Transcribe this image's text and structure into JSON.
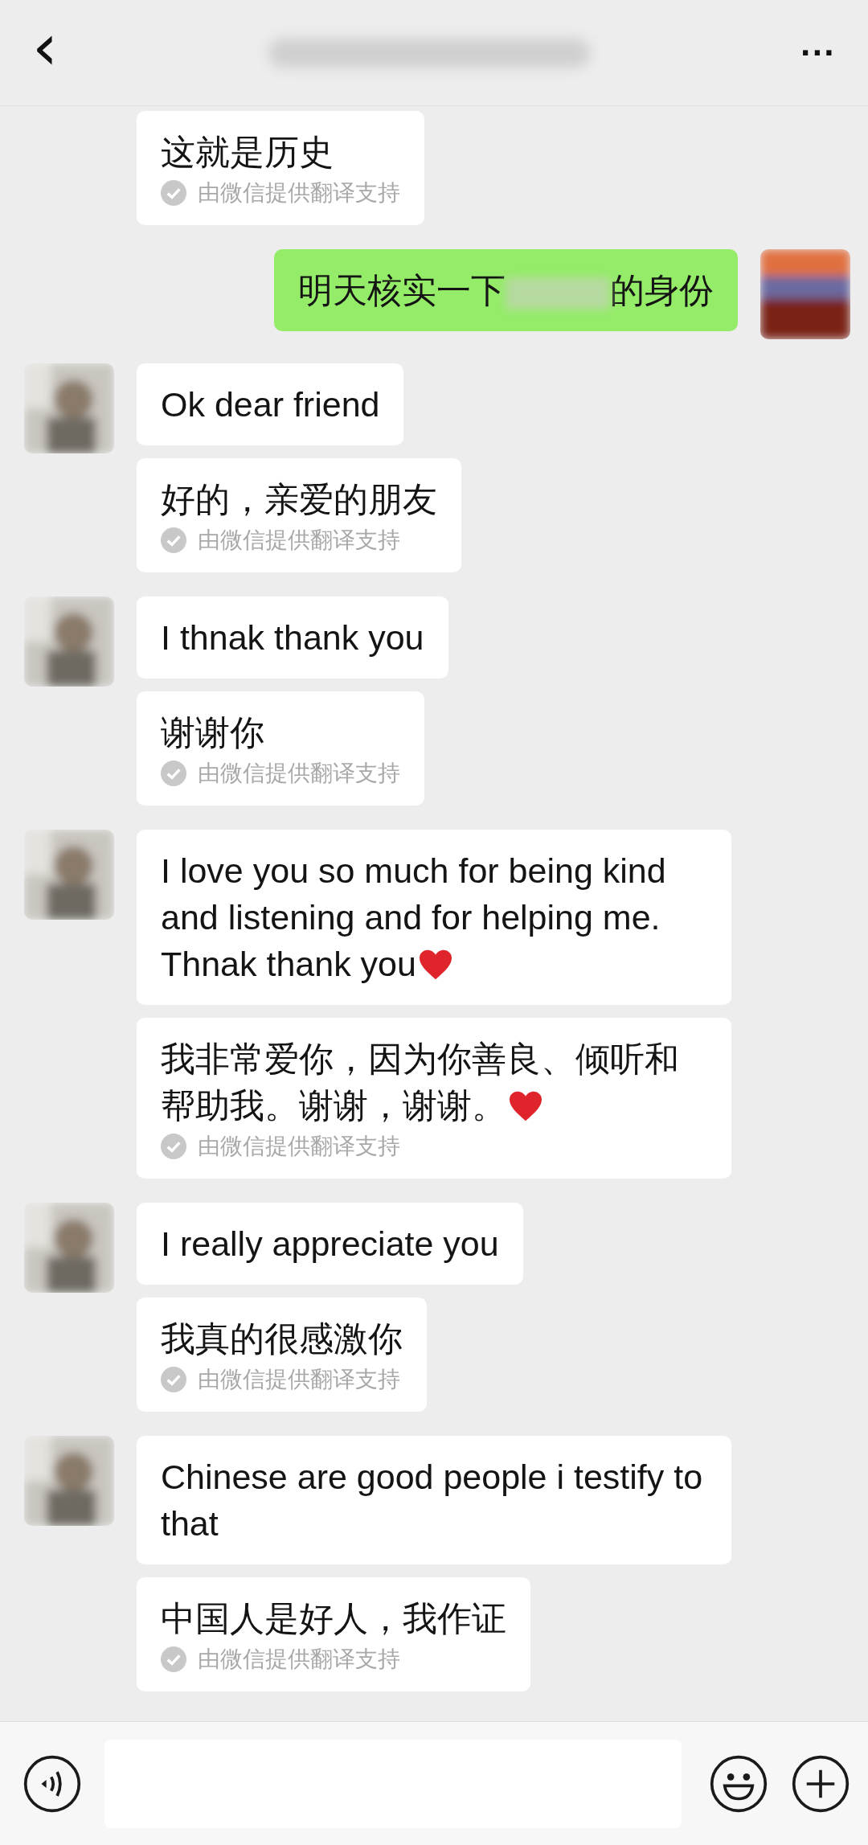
{
  "header": {
    "back": "‹",
    "more": "···"
  },
  "messages": [
    {
      "kind": "received_continued",
      "bubbles": [
        {
          "text": "这就是历史",
          "note": "由微信提供翻译支持",
          "heart": false
        }
      ]
    },
    {
      "kind": "sent",
      "bubbles": [
        {
          "text": "明天核实一下",
          "redacted": true,
          "text_after": "的身份",
          "heart": false
        }
      ]
    },
    {
      "kind": "received",
      "bubbles": [
        {
          "text": "Ok dear friend",
          "heart": false
        },
        {
          "text": "好的，亲爱的朋友",
          "note": "由微信提供翻译支持",
          "heart": false
        }
      ]
    },
    {
      "kind": "received",
      "bubbles": [
        {
          "text": "I thnak thank you",
          "heart": false
        },
        {
          "text": "谢谢你",
          "note": "由微信提供翻译支持",
          "heart": false
        }
      ]
    },
    {
      "kind": "received",
      "bubbles": [
        {
          "text": "I love you so much for being kind and listening and for helping me. Thnak thank you",
          "heart": true
        },
        {
          "text": "我非常爱你，因为你善良、倾听和帮助我。谢谢，谢谢。",
          "note": "由微信提供翻译支持",
          "heart": true
        }
      ]
    },
    {
      "kind": "received",
      "bubbles": [
        {
          "text": "I really appreciate you",
          "heart": false
        },
        {
          "text": "我真的很感激你",
          "note": "由微信提供翻译支持",
          "heart": false
        }
      ]
    },
    {
      "kind": "received",
      "bubbles": [
        {
          "text": "Chinese are good people i testify to that",
          "heart": false
        },
        {
          "text": "中国人是好人，我作证",
          "note": "由微信提供翻译支持",
          "heart": false
        }
      ]
    }
  ]
}
